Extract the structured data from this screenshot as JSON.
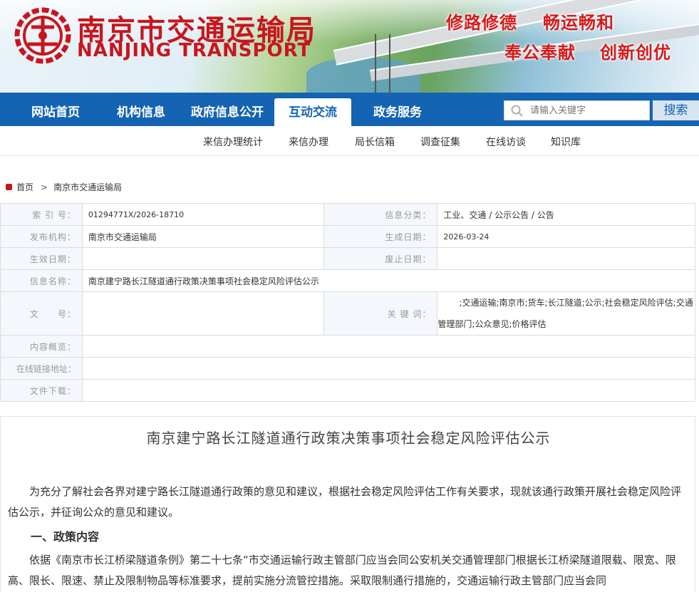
{
  "site": {
    "name_cn": "南京市交通运输局",
    "name_en": "NANJING TRANSPORT",
    "slogans": [
      "修路修德",
      "畅运畅和",
      "奉公奉献",
      "创新创优"
    ]
  },
  "nav": {
    "items": [
      "网站首页",
      "机构信息",
      "政府信息公开",
      "互动交流",
      "政务服务"
    ],
    "active": "互动交流",
    "search_placeholder": "请输入关键字",
    "search_button": "搜索"
  },
  "subnav": [
    "来信办理统计",
    "来信办理",
    "局长信箱",
    "调查征集",
    "在线访谈",
    "知识库"
  ],
  "breadcrumb": {
    "home": "首页",
    "current": "南京市交通运输局"
  },
  "meta": {
    "index_label": "索 引 号：",
    "index_value": "01294771X/2026-18710",
    "category_label": "信息分类：",
    "category_value": "工业、交通 / 公示公告 / 公告",
    "publisher_label": "发布机构：",
    "publisher_value": "南京市交通运输局",
    "created_label": "生成日期：",
    "created_value": "2026-03-24",
    "effective_label": "生效日期：",
    "effective_value": "",
    "expiry_label": "废止日期：",
    "expiry_value": "",
    "info_name_label": "信息名称：",
    "info_name_value": "南京建宁路长江隧道通行政策决策事项社会稳定风险评估公示",
    "doc_no_label": "文　　号：",
    "doc_no_value": "",
    "keywords_label": "关 键 词：",
    "keywords_value": ";交通运输;南京市;货车;长江隧道;公示;社会稳定风险评估;交通管理部门;公众意见;价格评估",
    "summary_label": "内容概览：",
    "link_label": "在线链接地址：",
    "download_label": "文件下载："
  },
  "article": {
    "title": "南京建宁路长江隧道通行政策决策事项社会稳定风险评估公示",
    "para1": "为充分了解社会各界对建宁路长江隧道通行政策的意见和建议，根据社会稳定风险评估工作有关要求，现就该通行政策开展社会稳定风险评估公示，并征询公众的意见和建议。",
    "heading1": "一、政策内容",
    "para2": "依据《南京市长江桥梁隧道条例》第二十七条“市交通运输行政主管部门应当会同公安机关交通管理部门根据长江桥梁隧道限载、限宽、限高、限长、限速、禁止及限制物品等标准要求，提前实施分流管控措施。采取限制通行措施的，交通运输行政主管部门应当会同"
  }
}
